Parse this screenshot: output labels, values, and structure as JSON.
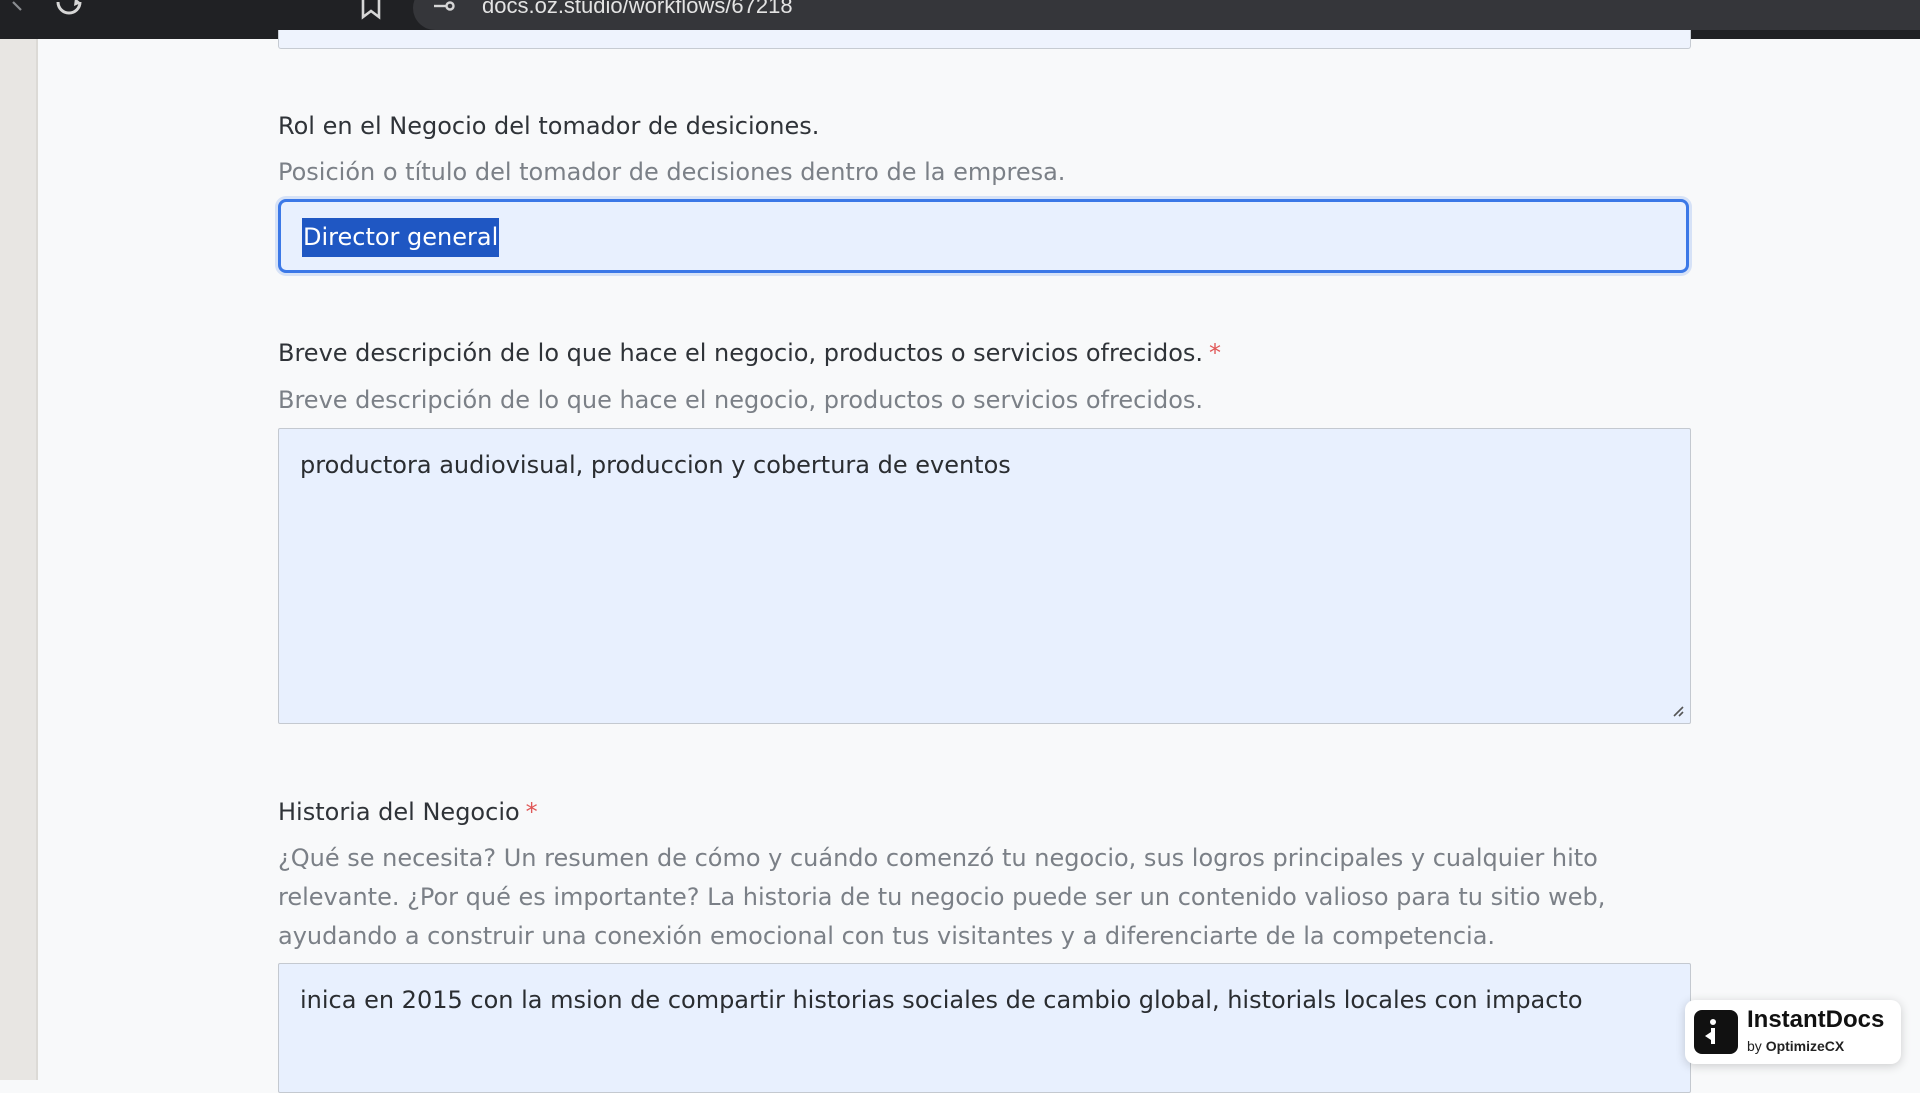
{
  "browser": {
    "url": "docs.oz.studio/workflows/67218",
    "icons": [
      "forward-icon",
      "reload-icon",
      "bookmark-icon",
      "site-settings-icon"
    ]
  },
  "fields": {
    "role": {
      "label": "Rol en el Negocio del tomador de desiciones.",
      "help": "Posición o título del tomador de decisiones dentro de la empresa.",
      "value": "Director general"
    },
    "description": {
      "label": "Breve descripción de lo que hace el negocio, productos o servicios ofrecidos.",
      "required_mark": "*",
      "help": "Breve descripción de lo que hace el negocio, productos o servicios ofrecidos.",
      "value": "productora audiovisual, produccion y cobertura de eventos"
    },
    "history": {
      "label": "Historia del Negocio",
      "required_mark": "*",
      "help_lines": [
        "¿Qué se necesita? Un resumen de cómo y cuándo comenzó tu negocio, sus logros principales y cualquier hito",
        "relevante. ¿Por qué es importante? La historia de tu negocio puede ser un contenido valioso para tu sitio web,",
        "ayudando a construir una conexión emocional con tus visitantes y a diferenciarte de la competencia."
      ],
      "value": "inica en 2015 con la msion de compartir historias sociales de cambio global, historials locales con impacto"
    }
  },
  "badge": {
    "title": "InstantDocs",
    "by": "by",
    "brand": "OptimizeCX",
    "icon": "instantdocs-logo-icon"
  },
  "colors": {
    "focus_border": "#3b78e7",
    "input_bg": "#e8f0fe",
    "selection": "#1f57c3",
    "required": "#e05757"
  }
}
